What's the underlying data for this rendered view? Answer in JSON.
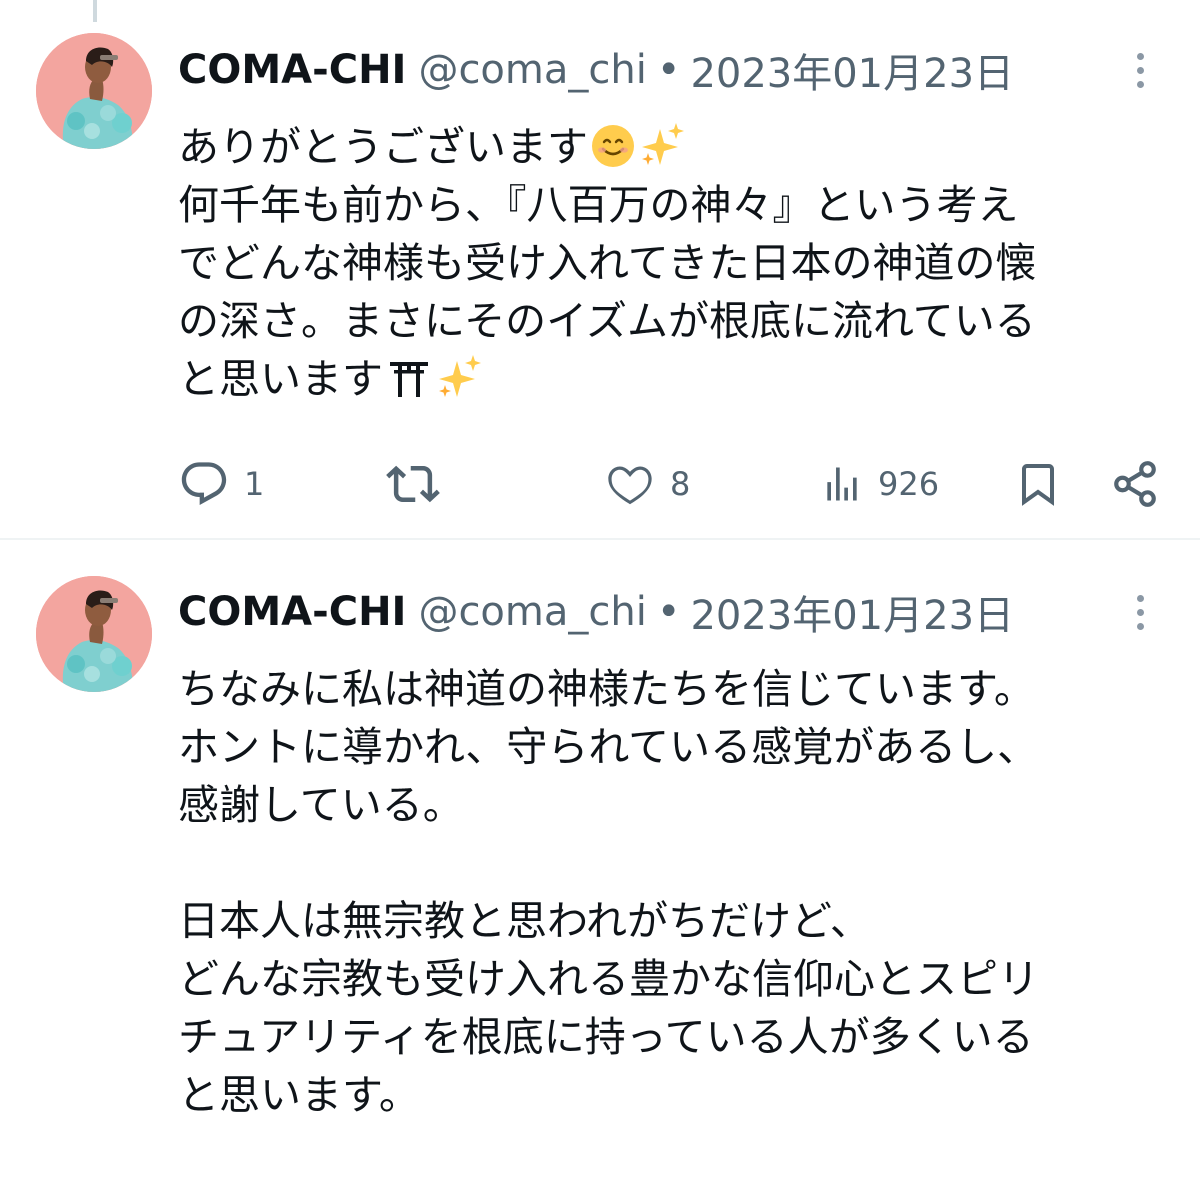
{
  "tweets": [
    {
      "author": {
        "name": "COMA-CHI",
        "handle": "@coma_chi"
      },
      "separator": "•",
      "date": "2023年01月23日",
      "body": {
        "line1": "ありがとうございます",
        "line2": "何千年も前から、『八百万の神々』という考え",
        "line3": "でどんな神様も受け入れてきた日本の神道の懐",
        "line4": "の深さ。まさにそのイズムが根底に流れている",
        "line5": "と思います"
      },
      "stats": {
        "replies": "1",
        "likes": "8",
        "views": "926"
      }
    },
    {
      "author": {
        "name": "COMA-CHI",
        "handle": "@coma_chi"
      },
      "separator": "•",
      "date": "2023年01月23日",
      "body": {
        "line1": "ちなみに私は神道の神様たちを信じています。",
        "line2": "ホントに導かれ、守られている感覚があるし、",
        "line3": "感謝している。",
        "line4": "",
        "line5": "日本人は無宗教と思われがちだけど、",
        "line6": "どんな宗教も受け入れる豊かな信仰心とスピリ",
        "line7": "チュアリティを根底に持っている人が多くいる",
        "line8": "と思います。"
      }
    }
  ],
  "icons": {
    "emoji1": "smiling-face-emoji",
    "emoji2": "sparkles-emoji",
    "emoji3": "torii-gate-emoji",
    "actions": [
      "reply-icon",
      "retweet-icon",
      "like-icon",
      "views-icon",
      "bookmark-icon",
      "share-icon",
      "more-icon"
    ]
  },
  "colors": {
    "text": "#0f1419",
    "secondary": "#536471",
    "divider": "#eff3f4"
  }
}
